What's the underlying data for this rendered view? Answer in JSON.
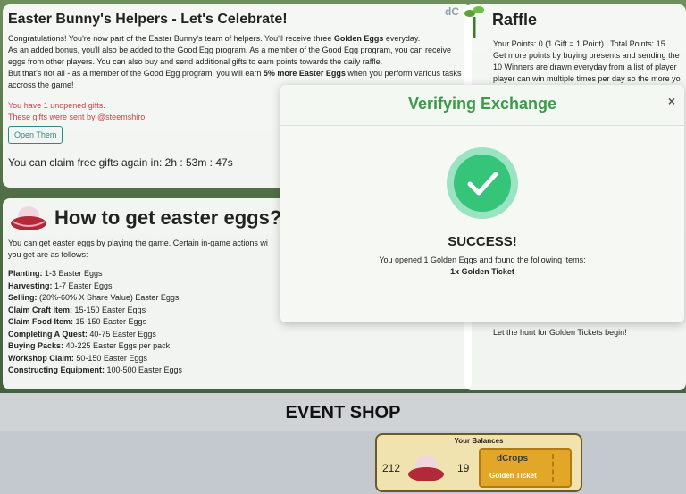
{
  "helpers": {
    "title": "Easter Bunny's Helpers - Let's Celebrate!",
    "p1_a": "Congratulations! You're now part of the Easter Bunny's team of helpers. You'll receive three ",
    "p1_b": "Golden Eggs",
    "p1_c": " everyday.",
    "p2": "As an added bonus, you'll also be added to the Good Egg program. As a member of the Good Egg program, you can receive eggs from other players. You can also buy and send additional gifts to earn points towards the daily raffle.",
    "p3_a": "But that's not all - as a member of the Good Egg program, you will earn ",
    "p3_b": "5% more Easter Eggs",
    "p3_c": " when you perform various tasks accross the game!",
    "unopened": "You have 1 unopened gifts.",
    "sent_by": "These gifts were sent by @steemshiro",
    "open_button": "Open Them",
    "timer": "You can claim free gifts again in: 2h : 53m : 47s"
  },
  "howto": {
    "title": "How to get easter eggs?",
    "intro": "You can get easter eggs by playing the game. Certain in-game actions wi",
    "intro2": "you get are as follows:",
    "items": [
      {
        "label": "Planting:",
        "value": " 1-3 Easter Eggs"
      },
      {
        "label": "Harvesting:",
        "value": " 1-7 Easter Eggs"
      },
      {
        "label": "Selling:",
        "value": " (20%-60% X Share Value) Easter Eggs"
      },
      {
        "label": "Claim Craft Item:",
        "value": " 15-150 Easter Eggs"
      },
      {
        "label": "Claim Food Item:",
        "value": " 15-150 Easter Eggs"
      },
      {
        "label": "Completing A Quest:",
        "value": " 40-75 Easter Eggs"
      },
      {
        "label": "Buying Packs:",
        "value": " 40-225 Easter Eggs per pack"
      },
      {
        "label": "Workshop Claim:",
        "value": " 50-150 Easter Eggs"
      },
      {
        "label": "Constructing Equipment:",
        "value": " 100-500 Easter Eggs"
      }
    ]
  },
  "raffle": {
    "title": "Raffle",
    "points": "Your Points: 0 (1 Gift = 1 Point) | Total Points: 15",
    "line2": "Get more points by buying presents and sending the",
    "line3": "10 Winners are drawn everyday from a list of player",
    "line4": "player can win multiple times per day so the more yo",
    "tail": "Let the hunt for Golden Tickets begin!"
  },
  "modal": {
    "title": "Verifying Exchange",
    "close": "×",
    "status": "SUCCESS!",
    "message": "You opened 1 Golden Eggs and found the following items:",
    "item": "1x Golden Ticket"
  },
  "shop": {
    "title": "EVENT SHOP",
    "balances_label": "Your Balances",
    "eggs": "212",
    "tickets": "19",
    "ticket_brand": "dCrops",
    "ticket_name": "Golden Ticket"
  },
  "colors": {
    "accent_green": "#3c9a4a",
    "success": "#36c47a",
    "warning_red": "#d23b4a",
    "teal": "#2c8a86"
  }
}
